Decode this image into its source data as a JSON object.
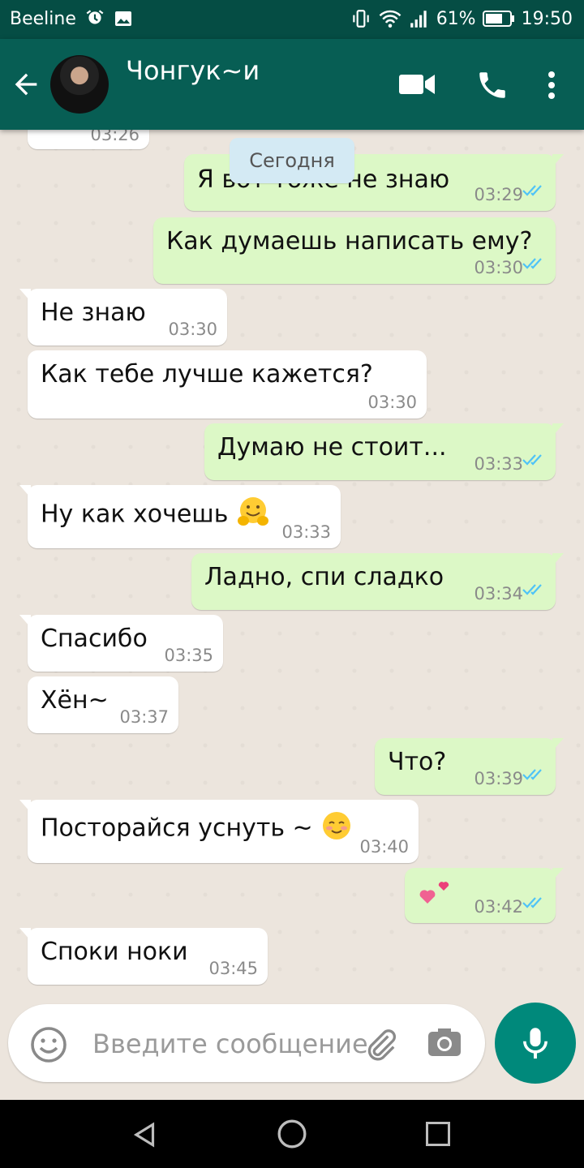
{
  "status_bar": {
    "carrier": "Beeline",
    "battery": "61%",
    "time": "19:50"
  },
  "header": {
    "contact_name": "Чонгук~и",
    "icons": [
      "back-arrow-icon",
      "video-call-icon",
      "phone-icon",
      "more-vert-icon"
    ]
  },
  "chat": {
    "date_label": "Сегодня",
    "partial_time": "03:26",
    "messages": [
      {
        "dir": "out",
        "text": "Я вот тоже не знаю",
        "time": "03:29"
      },
      {
        "dir": "out",
        "text": "Как думаешь написать ему?",
        "time": "03:30"
      },
      {
        "dir": "in",
        "text": "Не знаю",
        "time": "03:30"
      },
      {
        "dir": "in",
        "text": "Как тебе лучше кажется?",
        "time": "03:30"
      },
      {
        "dir": "out",
        "text": "Думаю не стоит...",
        "time": "03:33"
      },
      {
        "dir": "in",
        "text": "Ну как хочешь",
        "time": "03:33",
        "emoji": "hugging-face-icon"
      },
      {
        "dir": "out",
        "text": "Ладно, спи сладко",
        "time": "03:34"
      },
      {
        "dir": "in",
        "text": "Спасибо",
        "time": "03:35"
      },
      {
        "dir": "in",
        "text": "Хён~",
        "time": "03:37"
      },
      {
        "dir": "out",
        "text": "Что?",
        "time": "03:39"
      },
      {
        "dir": "in",
        "text": "Посторайся уснуть ~",
        "time": "03:40",
        "emoji": "smiling-face-icon"
      },
      {
        "dir": "out",
        "text": "",
        "time": "03:42",
        "emoji": "two-hearts-icon"
      },
      {
        "dir": "in",
        "text": "Споки ноки",
        "time": "03:45"
      }
    ]
  },
  "composer": {
    "placeholder": "Введите сообщение"
  },
  "colors": {
    "header": "#075e54",
    "status_bar": "#054d44",
    "outgoing_bubble": "#dcf8c6",
    "incoming_bubble": "#ffffff",
    "chat_bg": "#ece5dd",
    "fab": "#00897b",
    "read_ticks": "#4fc3f7"
  }
}
